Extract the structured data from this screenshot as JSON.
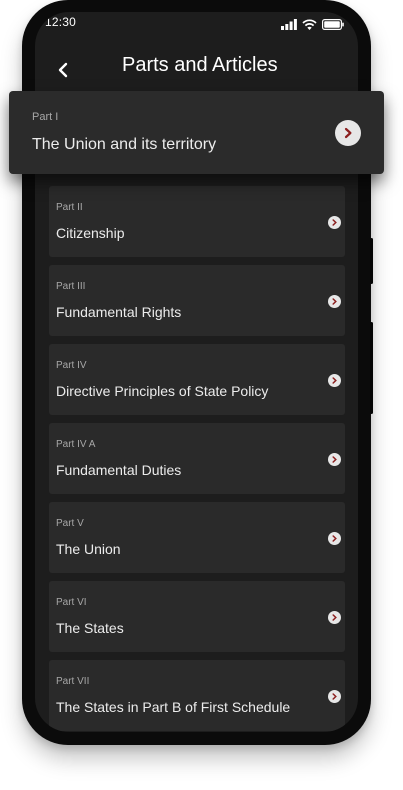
{
  "status_bar": {
    "time": "12:30",
    "icons": [
      "signal-icon",
      "wifi-icon",
      "battery-icon"
    ]
  },
  "header": {
    "title": "Parts and Articles",
    "back_icon": "back-arrow-icon"
  },
  "featured_part": {
    "label": "Part I",
    "title": "The Union and its territory",
    "chevron_icon": "chevron-right-icon"
  },
  "parts": [
    {
      "label": "Part II",
      "title": "Citizenship"
    },
    {
      "label": "Part III",
      "title": "Fundamental Rights"
    },
    {
      "label": "Part IV",
      "title": "Directive Principles of State Policy"
    },
    {
      "label": "Part IV A",
      "title": "Fundamental Duties"
    },
    {
      "label": "Part V",
      "title": "The Union"
    },
    {
      "label": "Part VI",
      "title": "The States"
    },
    {
      "label": "Part VII",
      "title": "The States in Part B of First Schedule"
    }
  ],
  "colors": {
    "screen_bg": "#1d1d1d",
    "card_bg": "#2a2a2a",
    "chevron_bg": "#e7e7e7",
    "chevron_arrow": "#8c1f1f"
  }
}
